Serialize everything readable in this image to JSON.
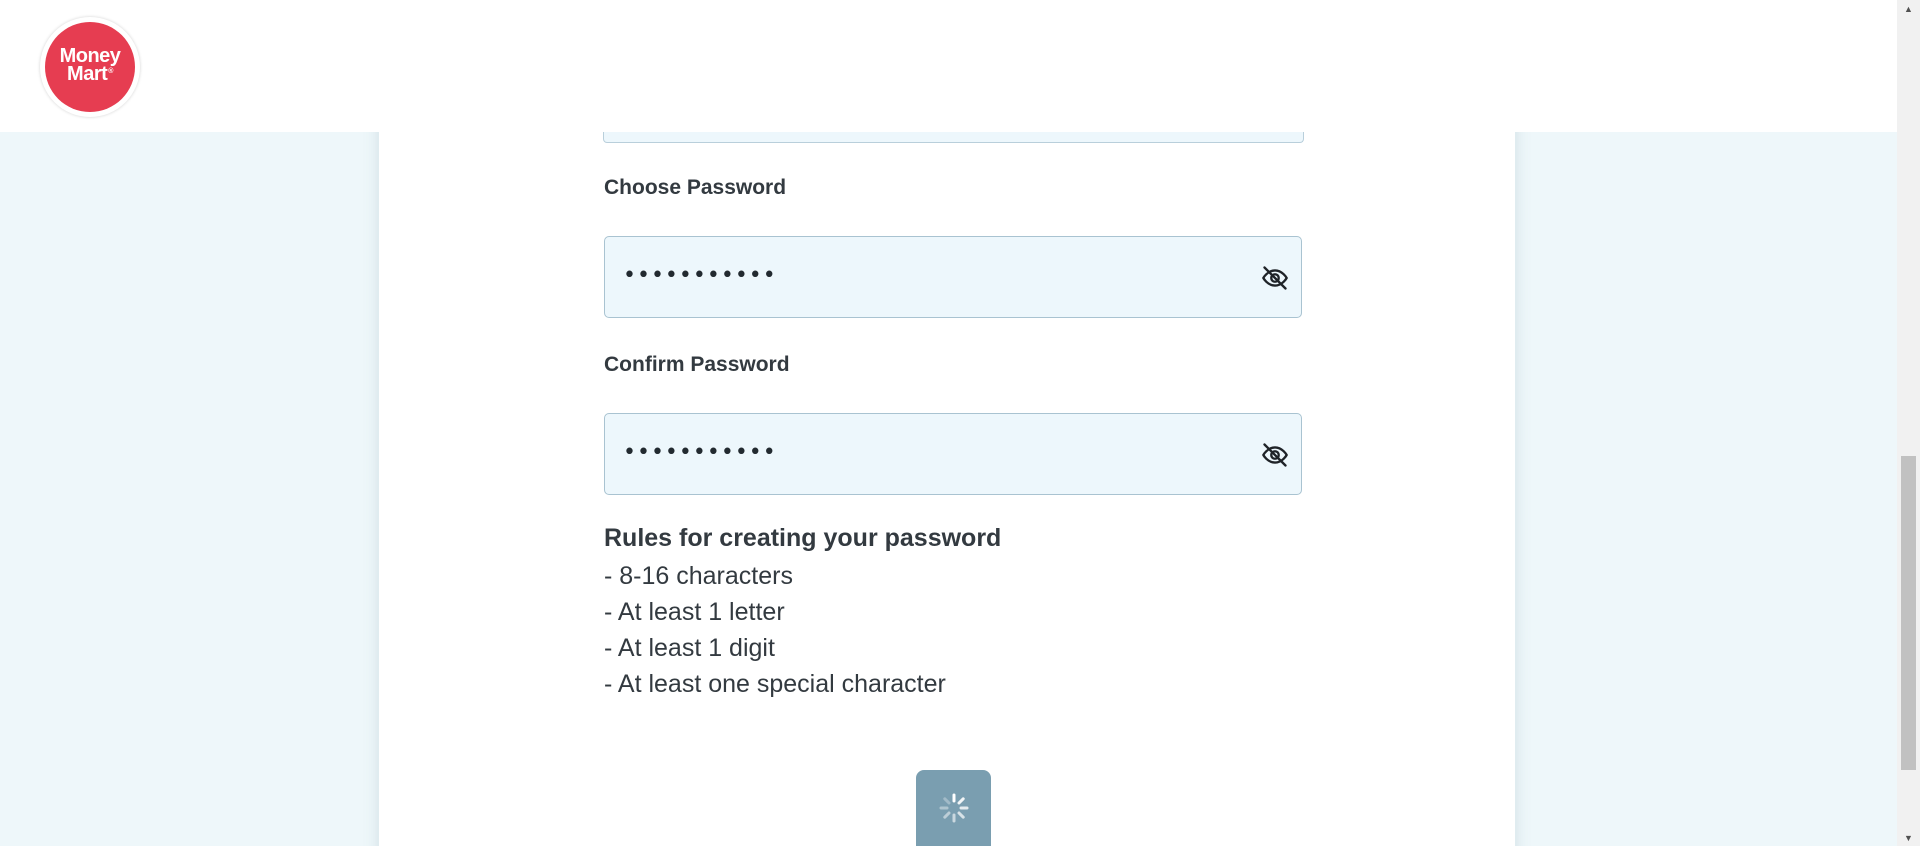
{
  "brand": {
    "logo_line1": "Money",
    "logo_line2": "Mart",
    "logo_reg": "®",
    "color": "#e63d51"
  },
  "form": {
    "choose_password": {
      "label": "Choose Password",
      "value": "•••••••••••",
      "toggle_icon": "eye-slash-icon"
    },
    "confirm_password": {
      "label": "Confirm Password",
      "value": "•••••••••••",
      "toggle_icon": "eye-slash-icon"
    },
    "rules": {
      "title": "Rules for creating your password",
      "items": [
        "- 8-16 characters",
        "- At least 1 letter",
        "- At least 1 digit",
        "- At least one special character"
      ]
    },
    "submit": {
      "state": "loading",
      "icon": "spinner-icon",
      "color": "#7a9eb0"
    }
  },
  "colors": {
    "background": "#eef7fa",
    "field_background": "#edf7fc",
    "text": "#333a40"
  }
}
